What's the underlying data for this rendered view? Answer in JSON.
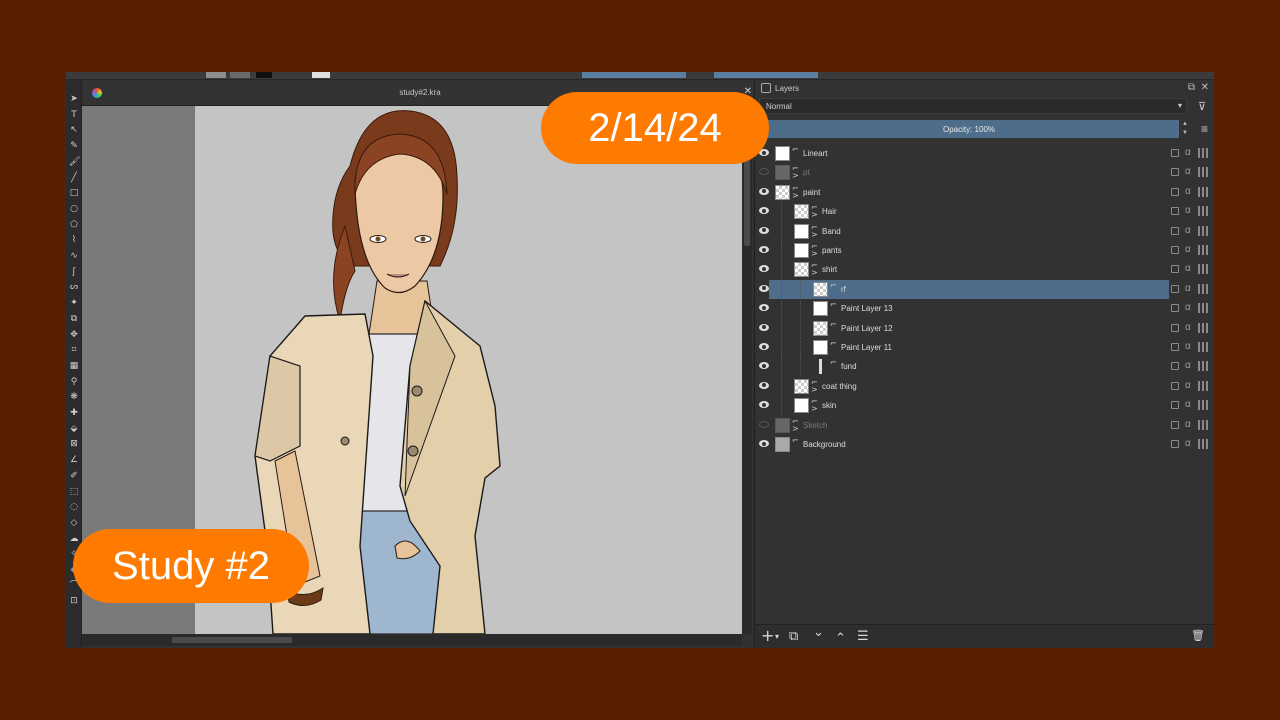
{
  "document": {
    "title": "study#2.kra",
    "close_glyph": "✕"
  },
  "toolbar": {
    "swatches": [
      "#8e8e8e",
      "#6a6a6a",
      "#111111",
      "#e0e0e0",
      "#5a7fa0",
      "#5a7fa0"
    ]
  },
  "toolbox": {
    "tools": [
      {
        "name": "select-shapes-icon",
        "glyph": "➤"
      },
      {
        "name": "text-tool-icon",
        "glyph": "T"
      },
      {
        "name": "edit-shapes-icon",
        "glyph": "↖"
      },
      {
        "name": "calligraphy-icon",
        "glyph": "✎"
      },
      {
        "name": "brush-tool-icon",
        "glyph": "🖌"
      },
      {
        "name": "line-tool-icon",
        "glyph": "╱"
      },
      {
        "name": "rectangle-tool-icon",
        "glyph": "□"
      },
      {
        "name": "ellipse-tool-icon",
        "glyph": "○"
      },
      {
        "name": "polygon-tool-icon",
        "glyph": "⬠"
      },
      {
        "name": "polyline-tool-icon",
        "glyph": "⌇"
      },
      {
        "name": "bezier-tool-icon",
        "glyph": "∿"
      },
      {
        "name": "freehand-path-icon",
        "glyph": "ʃ"
      },
      {
        "name": "dynamic-brush-icon",
        "glyph": "ᔕ"
      },
      {
        "name": "multibrush-icon",
        "glyph": "✦"
      },
      {
        "name": "transform-tool-icon",
        "glyph": "⧉"
      },
      {
        "name": "move-tool-icon",
        "glyph": "✥"
      },
      {
        "name": "crop-tool-icon",
        "glyph": "⌗"
      },
      {
        "name": "gradient-tool-icon",
        "glyph": "▦"
      },
      {
        "name": "color-picker-icon",
        "glyph": "⚲"
      },
      {
        "name": "colorize-mask-icon",
        "glyph": "❋"
      },
      {
        "name": "smart-patch-icon",
        "glyph": "✚"
      },
      {
        "name": "fill-tool-icon",
        "glyph": "⬙"
      },
      {
        "name": "assistant-tool-icon",
        "glyph": "⊠"
      },
      {
        "name": "measure-tool-icon",
        "glyph": "∠"
      },
      {
        "name": "reference-tool-icon",
        "glyph": "✐"
      },
      {
        "name": "rect-select-icon",
        "glyph": "⬚"
      },
      {
        "name": "ellipse-select-icon",
        "glyph": "◌"
      },
      {
        "name": "polygon-select-icon",
        "glyph": "◇"
      },
      {
        "name": "freehand-select-icon",
        "glyph": "☁"
      },
      {
        "name": "contiguous-select-icon",
        "glyph": "✧"
      },
      {
        "name": "similar-select-icon",
        "glyph": "◈"
      },
      {
        "name": "bezier-select-icon",
        "glyph": "⌒"
      },
      {
        "name": "magnetic-select-icon",
        "glyph": "⊡"
      }
    ]
  },
  "layers": {
    "title": "Layers",
    "blend_mode": "Normal",
    "opacity_label": "Opacity:  100%",
    "dock_float_glyph": "⧉",
    "dock_close_glyph": "✕",
    "filter_glyph": "⊽",
    "menu_glyph": "≡",
    "items": [
      {
        "name": "Lineart",
        "visible": true,
        "thumb": "white",
        "group": false,
        "indent": 0,
        "selected": false
      },
      {
        "name": "pt",
        "visible": false,
        "thumb": "gray",
        "group": true,
        "indent": 0,
        "selected": false
      },
      {
        "name": "paint",
        "visible": true,
        "thumb": "checker",
        "group": true,
        "indent": 0,
        "selected": false
      },
      {
        "name": "Hair",
        "visible": true,
        "thumb": "checker",
        "group": true,
        "indent": 1,
        "selected": false
      },
      {
        "name": "Band",
        "visible": true,
        "thumb": "white",
        "group": true,
        "indent": 1,
        "selected": false
      },
      {
        "name": "pants",
        "visible": true,
        "thumb": "white",
        "group": true,
        "indent": 1,
        "selected": false
      },
      {
        "name": "shirt",
        "visible": true,
        "thumb": "checker",
        "group": true,
        "indent": 1,
        "selected": false
      },
      {
        "name": "rf",
        "visible": true,
        "thumb": "checker",
        "group": false,
        "indent": 2,
        "selected": true
      },
      {
        "name": "Paint Layer 13",
        "visible": true,
        "thumb": "white",
        "group": false,
        "indent": 2,
        "selected": false
      },
      {
        "name": "Paint Layer 12",
        "visible": true,
        "thumb": "checker",
        "group": false,
        "indent": 2,
        "selected": false
      },
      {
        "name": "Paint Layer 11",
        "visible": true,
        "thumb": "white",
        "group": false,
        "indent": 2,
        "selected": false
      },
      {
        "name": "fund",
        "visible": true,
        "thumb": "none",
        "group": false,
        "indent": 2,
        "selected": false
      },
      {
        "name": "coat thing",
        "visible": true,
        "thumb": "checker",
        "group": true,
        "indent": 1,
        "selected": false
      },
      {
        "name": "skin",
        "visible": true,
        "thumb": "white",
        "group": true,
        "indent": 1,
        "selected": false
      },
      {
        "name": "Sketch",
        "visible": false,
        "thumb": "gray",
        "group": true,
        "indent": 0,
        "selected": false
      },
      {
        "name": "Background",
        "visible": true,
        "thumb": "gray",
        "group": false,
        "indent": 0,
        "selected": false
      }
    ],
    "footer": {
      "add_glyph": "+",
      "add_menu_glyph": "▾",
      "duplicate_glyph": "⧉",
      "move_down_glyph": "⌄",
      "move_up_glyph": "⌃",
      "properties_glyph": "☰",
      "delete_glyph": "🗑"
    }
  },
  "overlay": {
    "date_label": "2/14/24",
    "study_label": "Study #2",
    "accent_color": "#ff7a00",
    "background_color": "#5a1e00"
  }
}
